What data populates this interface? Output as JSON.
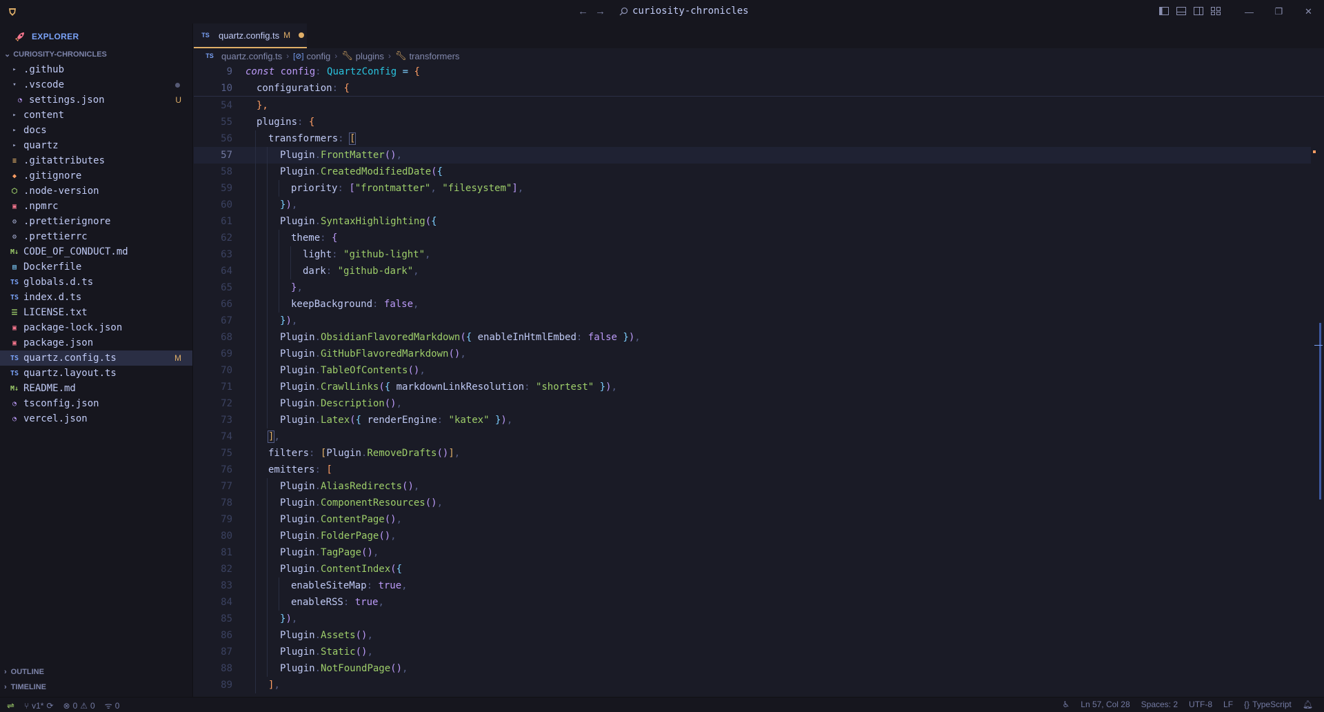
{
  "titlebar": {
    "search_text": "curiosity-chronicles",
    "back_icon": "←",
    "forward_icon": "→",
    "minimize": "—",
    "restore": "❐",
    "close": "✕"
  },
  "sidebar": {
    "explorer_title": "EXPLORER",
    "workspace_title": "CURIOSITY-CHRONICLES",
    "items": [
      {
        "label": ".github",
        "kind": "folder",
        "expanded": false
      },
      {
        "label": ".vscode",
        "kind": "folder",
        "expanded": true,
        "dot": true
      },
      {
        "label": "settings.json",
        "kind": "settings",
        "badge": "U",
        "indent": 1
      },
      {
        "label": "content",
        "kind": "folder",
        "expanded": false
      },
      {
        "label": "docs",
        "kind": "folder",
        "expanded": false
      },
      {
        "label": "quartz",
        "kind": "folder",
        "expanded": false
      },
      {
        "label": ".gitattributes",
        "kind": "lines"
      },
      {
        "label": ".gitignore",
        "kind": "git"
      },
      {
        "label": ".node-version",
        "kind": "node"
      },
      {
        "label": ".npmrc",
        "kind": "npm"
      },
      {
        "label": ".prettierignore",
        "kind": "gear"
      },
      {
        "label": ".prettierrc",
        "kind": "gear"
      },
      {
        "label": "CODE_OF_CONDUCT.md",
        "kind": "md"
      },
      {
        "label": "Dockerfile",
        "kind": "docker"
      },
      {
        "label": "globals.d.ts",
        "kind": "ts"
      },
      {
        "label": "index.d.ts",
        "kind": "ts"
      },
      {
        "label": "LICENSE.txt",
        "kind": "txt"
      },
      {
        "label": "package-lock.json",
        "kind": "npm"
      },
      {
        "label": "package.json",
        "kind": "npm"
      },
      {
        "label": "quartz.config.ts",
        "kind": "ts",
        "badge": "M",
        "selected": true
      },
      {
        "label": "quartz.layout.ts",
        "kind": "ts"
      },
      {
        "label": "README.md",
        "kind": "md"
      },
      {
        "label": "tsconfig.json",
        "kind": "settings"
      },
      {
        "label": "vercel.json",
        "kind": "settings"
      }
    ],
    "outline_label": "OUTLINE",
    "timeline_label": "TIMELINE"
  },
  "tab": {
    "label": "quartz.config.ts",
    "status": "M"
  },
  "breadcrumb": {
    "file": "quartz.config.ts",
    "b1": "config",
    "b2": "plugins",
    "b3": "transformers"
  },
  "editor": {
    "current_line": 57,
    "lines": [
      {
        "n": "9",
        "sticky": true
      },
      {
        "n": "10",
        "sticky": true
      },
      {
        "n": "54"
      },
      {
        "n": "55"
      },
      {
        "n": "56"
      },
      {
        "n": "57",
        "active": true
      },
      {
        "n": "58"
      },
      {
        "n": "59"
      },
      {
        "n": "60"
      },
      {
        "n": "61"
      },
      {
        "n": "62"
      },
      {
        "n": "63"
      },
      {
        "n": "64"
      },
      {
        "n": "65"
      },
      {
        "n": "66"
      },
      {
        "n": "67"
      },
      {
        "n": "68"
      },
      {
        "n": "69"
      },
      {
        "n": "70"
      },
      {
        "n": "71"
      },
      {
        "n": "72"
      },
      {
        "n": "73"
      },
      {
        "n": "74"
      },
      {
        "n": "75"
      },
      {
        "n": "76"
      },
      {
        "n": "77"
      },
      {
        "n": "78"
      },
      {
        "n": "79"
      },
      {
        "n": "80"
      },
      {
        "n": "81"
      },
      {
        "n": "82"
      },
      {
        "n": "83"
      },
      {
        "n": "84"
      },
      {
        "n": "85"
      },
      {
        "n": "86"
      },
      {
        "n": "87"
      },
      {
        "n": "88"
      },
      {
        "n": "89"
      }
    ],
    "code": {
      "l9_kw": "const",
      "l9_var": "config",
      "l9_type": "QuartzConfig",
      "l9_eq": "=",
      "l9_br": "{",
      "l10_key": "configuration",
      "l10_br": "{",
      "l54": "},",
      "l55_key": "plugins",
      "l55_br": "{",
      "l56_key": "transformers",
      "l56_br": "[",
      "plugin": "Plugin",
      "l57_fn": "FrontMatter",
      "l58_fn": "CreatedModifiedDate",
      "l59_key": "priority",
      "l59_s1": "\"frontmatter\"",
      "l59_s2": "\"filesystem\"",
      "l61_fn": "SyntaxHighlighting",
      "l62_key": "theme",
      "l63_key": "light",
      "l63_s": "\"github-light\"",
      "l64_key": "dark",
      "l64_s": "\"github-dark\"",
      "l66_key": "keepBackground",
      "l66_v": "false",
      "l68_fn": "ObsidianFlavoredMarkdown",
      "l68_key": "enableInHtmlEmbed",
      "l68_v": "false",
      "l69_fn": "GitHubFlavoredMarkdown",
      "l70_fn": "TableOfContents",
      "l71_fn": "CrawlLinks",
      "l71_key": "markdownLinkResolution",
      "l71_s": "\"shortest\"",
      "l72_fn": "Description",
      "l73_fn": "Latex",
      "l73_key": "renderEngine",
      "l73_s": "\"katex\"",
      "l75_key": "filters",
      "l75_fn": "RemoveDrafts",
      "l76_key": "emitters",
      "l77_fn": "AliasRedirects",
      "l78_fn": "ComponentResources",
      "l79_fn": "ContentPage",
      "l80_fn": "FolderPage",
      "l81_fn": "TagPage",
      "l82_fn": "ContentIndex",
      "l83_key": "enableSiteMap",
      "l83_v": "true",
      "l84_key": "enableRSS",
      "l84_v": "true",
      "l86_fn": "Assets",
      "l87_fn": "Static",
      "l88_fn": "NotFoundPage"
    }
  },
  "statusbar": {
    "branch": "v1*",
    "errors": "0",
    "warnings": "0",
    "ports": "0",
    "position": "Ln 57, Col 28",
    "spaces": "Spaces: 2",
    "encoding": "UTF-8",
    "eol": "LF",
    "language": "TypeScript"
  },
  "colors": {
    "accent": "#7aa2f7",
    "modified": "#e0af68",
    "background": "#1a1b26",
    "sidebar": "#16161e"
  }
}
